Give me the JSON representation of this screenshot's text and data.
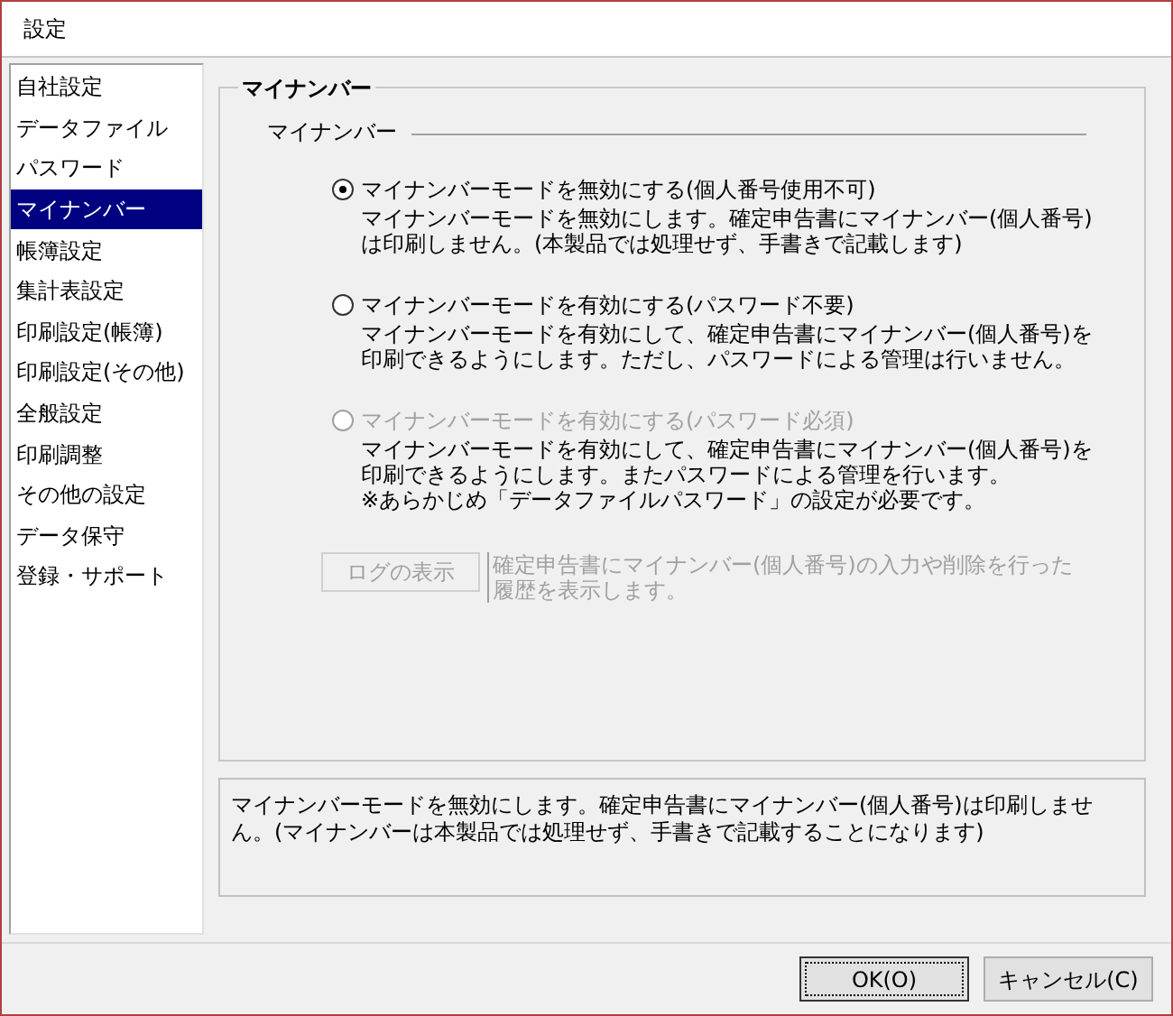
{
  "window": {
    "title": "設定"
  },
  "sidebar": {
    "items": [
      {
        "label": "自社設定",
        "selected": false
      },
      {
        "label": "データファイル",
        "selected": false
      },
      {
        "label": "パスワード",
        "selected": false
      },
      {
        "label": "マイナンバー",
        "selected": true
      },
      {
        "label": "帳簿設定",
        "selected": false
      },
      {
        "label": "集計表設定",
        "selected": false
      },
      {
        "label": "印刷設定(帳簿)",
        "selected": false
      },
      {
        "label": "印刷設定(その他)",
        "selected": false
      },
      {
        "label": "全般設定",
        "selected": false
      },
      {
        "label": "印刷調整",
        "selected": false
      },
      {
        "label": "その他の設定",
        "selected": false
      },
      {
        "label": "データ保守",
        "selected": false
      },
      {
        "label": "登録・サポート",
        "selected": false
      }
    ]
  },
  "panel": {
    "title": "マイナンバー",
    "section_label": "マイナンバー",
    "options": [
      {
        "label": "マイナンバーモードを無効にする(個人番号使用不可)",
        "selected": true,
        "disabled": false,
        "description_lines": [
          "マイナンバーモードを無効にします。確定申告書にマイナンバー(個人番号)",
          "は印刷しません。(本製品では処理せず、手書きで記載します)"
        ]
      },
      {
        "label": "マイナンバーモードを有効にする(パスワード不要)",
        "selected": false,
        "disabled": false,
        "description_lines": [
          "マイナンバーモードを有効にして、確定申告書にマイナンバー(個人番号)を",
          "印刷できるようにします。ただし、パスワードによる管理は行いません。"
        ]
      },
      {
        "label": "マイナンバーモードを有効にする(パスワード必須)",
        "selected": false,
        "disabled": true,
        "description_lines": [
          "マイナンバーモードを有効にして、確定申告書にマイナンバー(個人番号)を",
          "印刷できるようにします。またパスワードによる管理を行います。",
          "※あらかじめ「データファイルパスワード」の設定が必要です。"
        ]
      }
    ],
    "log_button": {
      "label": "ログの表示",
      "disabled": true,
      "description_lines": [
        "確定申告書にマイナンバー(個人番号)の入力や削除を行った",
        "履歴を表示します。"
      ]
    }
  },
  "help_text": "マイナンバーモードを無効にします。確定申告書にマイナンバー(個人番号)は印刷しません。(マイナンバーは本製品では処理せず、手書きで記載することになります)",
  "buttons": [
    {
      "label": "OK(O)",
      "focused": true
    },
    {
      "label": "キャンセル(C)",
      "focused": false
    }
  ]
}
